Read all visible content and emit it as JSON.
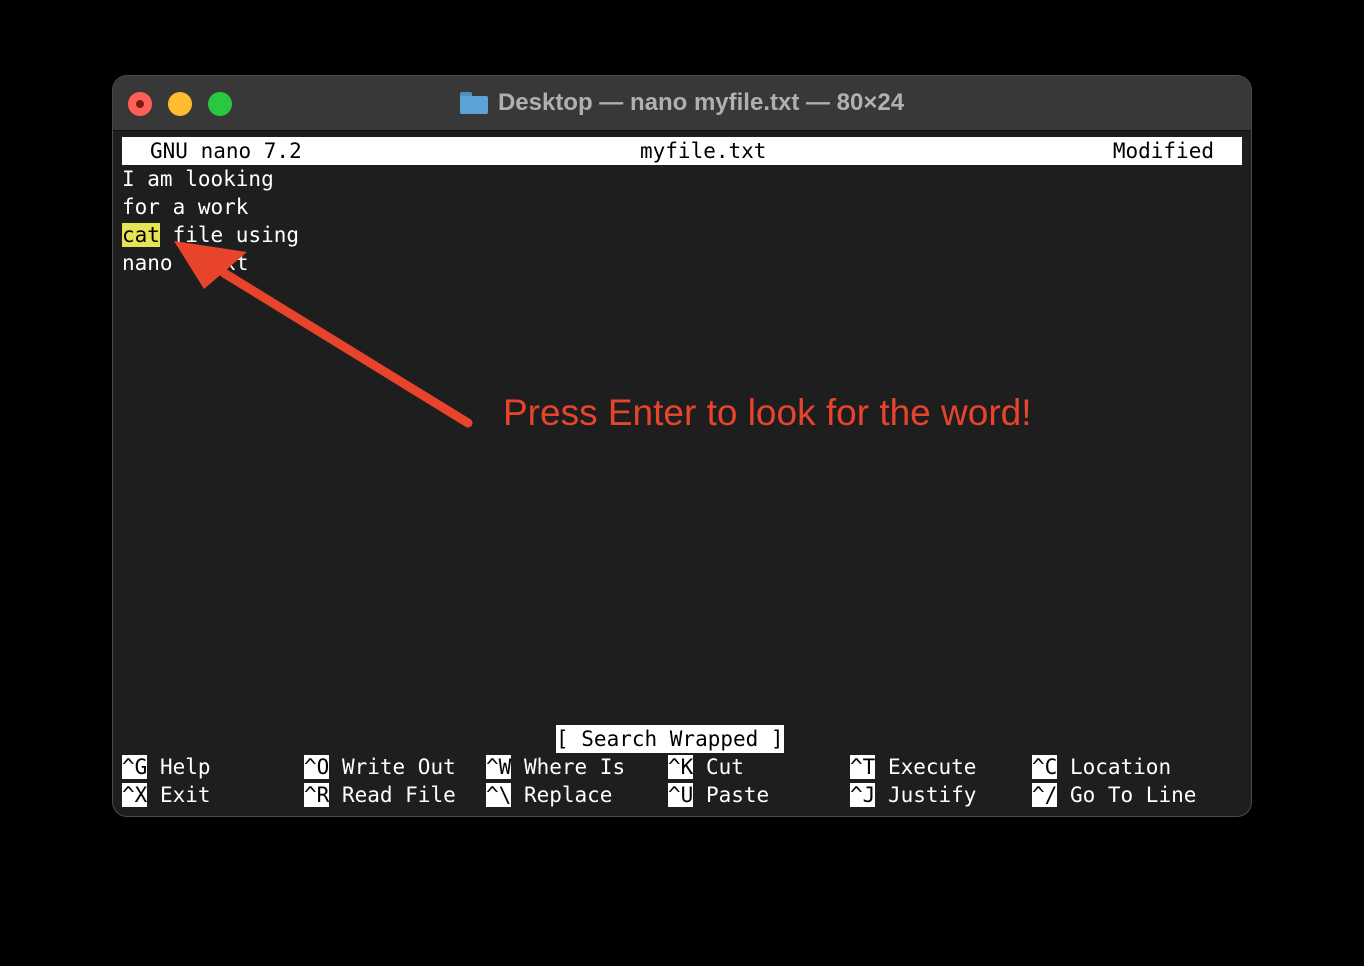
{
  "window": {
    "title": "Desktop — nano myfile.txt — 80×24",
    "folder_icon": "folder-icon"
  },
  "nano": {
    "version": "GNU nano 7.2",
    "filename": "myfile.txt",
    "state": "Modified"
  },
  "buffer": {
    "lines": [
      "I am looking",
      "for a work",
      "file using",
      "nano ... xt"
    ],
    "highlight_word": "cat",
    "line3_rest": " file using",
    "line4_visible_start": "nano ",
    "line4_visible_end": "xt"
  },
  "status_message": "[ Search Wrapped ]",
  "shortcuts": {
    "row1": [
      {
        "key": "^G",
        "label": "Help"
      },
      {
        "key": "^O",
        "label": "Write Out"
      },
      {
        "key": "^W",
        "label": "Where Is"
      },
      {
        "key": "^K",
        "label": "Cut"
      },
      {
        "key": "^T",
        "label": "Execute"
      },
      {
        "key": "^C",
        "label": "Location"
      }
    ],
    "row2": [
      {
        "key": "^X",
        "label": "Exit"
      },
      {
        "key": "^R",
        "label": "Read File"
      },
      {
        "key": "^\\",
        "label": "Replace"
      },
      {
        "key": "^U",
        "label": "Paste"
      },
      {
        "key": "^J",
        "label": "Justify"
      },
      {
        "key": "^/",
        "label": "Go To Line"
      }
    ]
  },
  "annotation": {
    "text": "Press Enter to look for the word!",
    "color": "#e8442c"
  },
  "colors": {
    "highlight": "#e4e454",
    "terminal_bg": "#1e1e1e",
    "titlebar_bg": "#383838"
  }
}
